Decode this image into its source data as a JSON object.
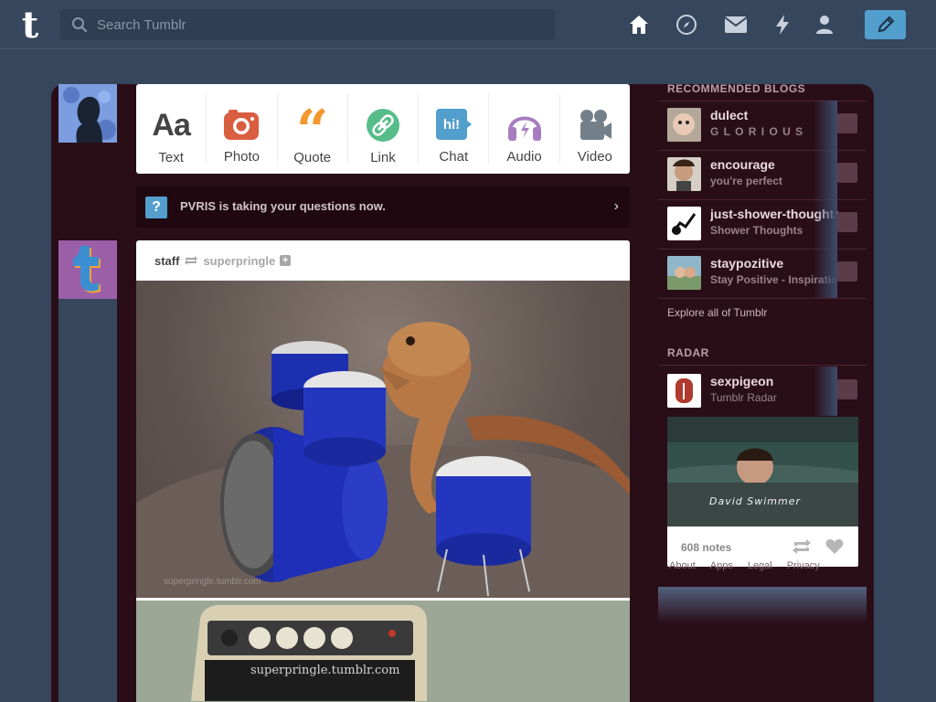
{
  "header": {
    "search_placeholder": "Search Tumblr",
    "logo_letter": "t"
  },
  "post_types": [
    {
      "label": "Text",
      "icon": "text-icon",
      "color": "#444444"
    },
    {
      "label": "Photo",
      "icon": "camera-icon",
      "color": "#d95e40"
    },
    {
      "label": "Quote",
      "icon": "quote-icon",
      "color": "#f2992e"
    },
    {
      "label": "Link",
      "icon": "link-icon",
      "color": "#56bc8a"
    },
    {
      "label": "Chat",
      "icon": "chat-icon",
      "color": "#529ecc"
    },
    {
      "label": "Audio",
      "icon": "headphones-icon",
      "color": "#a77dc2"
    },
    {
      "label": "Video",
      "icon": "video-camera-icon",
      "color": "#748089"
    }
  ],
  "chat_icon_text": "hi!",
  "banner": {
    "icon": "?",
    "text": "PVRIS is taking your questions now."
  },
  "post": {
    "author": "staff",
    "reblogged_from": "superpringle",
    "photo1_watermark": "superpringle.tumblr.com",
    "photo2_watermark": "superpringle.tumblr.com"
  },
  "recommended": {
    "title": "RECOMMENDED BLOGS",
    "blogs": [
      {
        "name": "dulect",
        "subtitle": "G L O R I O U S"
      },
      {
        "name": "encourage",
        "subtitle": "you're perfect"
      },
      {
        "name": "just-shower-thoughts",
        "subtitle": "Shower Thoughts"
      },
      {
        "name": "staypozitive",
        "subtitle": "Stay Positive - Inspiration"
      }
    ],
    "explore": "Explore all of Tumblr"
  },
  "radar": {
    "title": "RADAR",
    "blog_name": "sexpigeon",
    "blog_sub": "Tumblr Radar",
    "image_caption": "David Swimmer",
    "notes": "608 notes"
  },
  "footer_links": [
    "About",
    "Apps",
    "Legal",
    "Privacy"
  ],
  "colors": {
    "header_bg": "#36465d",
    "panel_bg": "#2a0e17",
    "compose": "#529ecc"
  }
}
